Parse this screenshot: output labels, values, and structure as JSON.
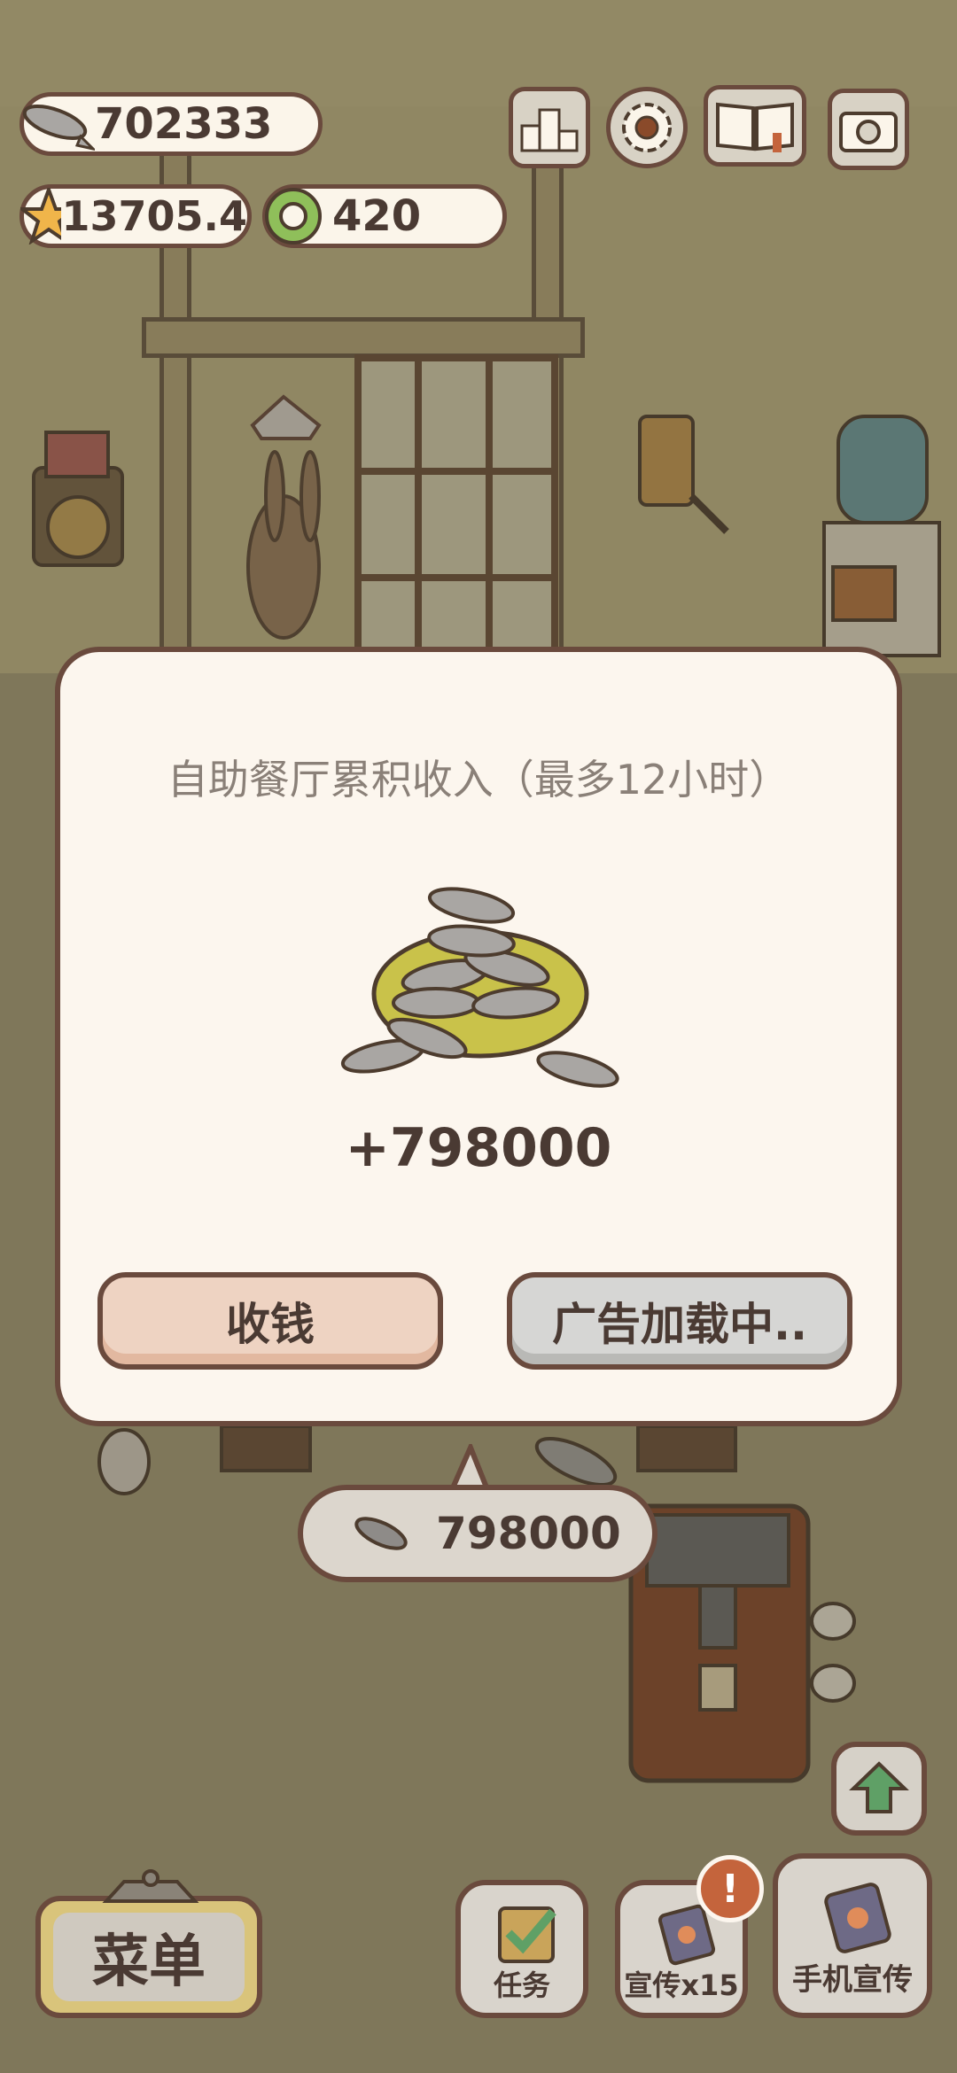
{
  "hud": {
    "fish_count": "702333",
    "star_rating": "13705.4",
    "coupon_count": "420"
  },
  "dialog": {
    "title": "自助餐厅累积收入（最多12小时）",
    "amount": "+798000",
    "collect_label": "收钱",
    "ad_label": "广告加载中.."
  },
  "bubble": {
    "amount": "798000"
  },
  "bottom": {
    "menu_label": "菜单",
    "tasks_label": "任务",
    "promote_label": "宣传x15",
    "phone_promote_label": "手机宣传",
    "badge_text": "!"
  },
  "colors": {
    "outline": "#6a4a3d",
    "dialog_bg": "#fcf6ee",
    "collect_button": "#eed3c2",
    "ad_button": "#d6d6d4",
    "star": "#f0b54a",
    "coupon": "#8fbf5a",
    "badge": "#c4643c"
  }
}
